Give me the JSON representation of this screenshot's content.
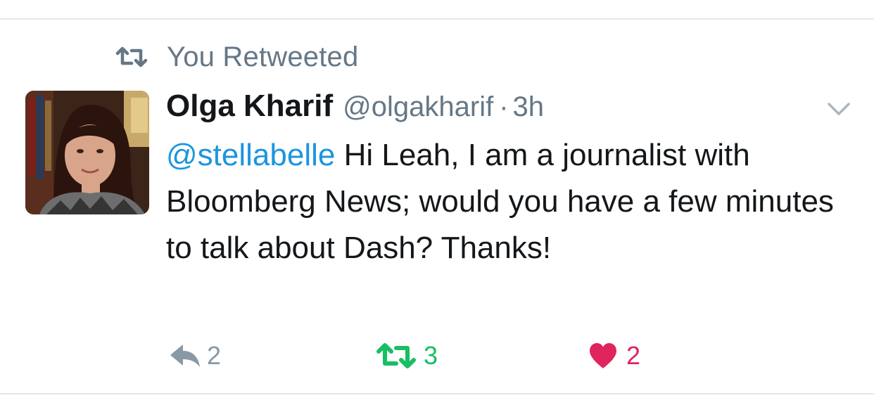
{
  "social_context": {
    "label": "You Retweeted",
    "icon": "retweet-icon"
  },
  "tweet": {
    "author_name": "Olga Kharif",
    "handle": "@olgakharif",
    "separator": "·",
    "time": "3h",
    "mention": "@stellabelle",
    "text": "Hi Leah, I am a journalist with Bloomberg News; would you have a few minutes to talk about Dash? Thanks!",
    "menu_icon": "chevron-down-icon"
  },
  "actions": {
    "reply": {
      "icon": "reply-icon",
      "count": "2"
    },
    "retweet": {
      "icon": "retweet-icon",
      "count": "3",
      "active": true
    },
    "like": {
      "icon": "heart-icon",
      "count": "2",
      "active": true
    }
  },
  "colors": {
    "secondary_text": "#657786",
    "link": "#1b95e0",
    "retweet_active": "#17bf63",
    "like_active": "#e0245e",
    "divider": "#e1e8ed"
  }
}
